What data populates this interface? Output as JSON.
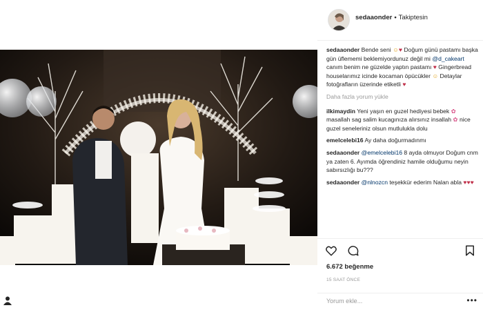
{
  "post": {
    "username": "sedaaonder",
    "separator": "•",
    "follow_status": "Takiptesin",
    "likes": "6.672 beğenme",
    "time": "15 SAAT ÖNCE",
    "comment_placeholder": "Yorum ekle...",
    "more_options": "•••",
    "more_comments": "Daha fazla yorum yükle"
  },
  "caption": {
    "user": "sedaaonder",
    "t1": "Bende seni",
    "t2": "Doğum günü pastamı başka gün üflememi beklemiyordunuz değil mi",
    "mention": "@d_cakeart",
    "t3": "canım benim ne güzelde yaptın pastamı",
    "t4": "Gingerbread houselarımız icinde kocaman öpücükler",
    "t5": "Detaylar fotoğrafların üzerinde etiketli"
  },
  "comments": [
    {
      "user": "ilkimaydin",
      "t1": "Yeni yaşın en guzel hediyesi bebek",
      "t2": "masallah sag salim kucagınıza alırsınız insallah",
      "t3": "nice guzel seneleriniz olsun mutlulukla dolu"
    },
    {
      "user": "emelcelebi16",
      "t1": "Ay daha doğurmadınmı"
    },
    {
      "user": "sedaaonder",
      "mention": "@emelcelebi16",
      "t1": "8 ayda olmuyor Doğum cnm ya zaten 6. Ayımda öğrendiniz hamile olduğumu neyin sabırsızlığı bu???"
    },
    {
      "user": "sedaaonder",
      "mention": "@nlnozcn",
      "t1": "teşekkür ederim",
      "t2": "Nalan abla"
    }
  ],
  "icons": {
    "heart": "heart-icon",
    "comment": "comment-icon",
    "bookmark": "bookmark-icon",
    "avatar": "avatar"
  },
  "colors": {
    "text": "#262626",
    "muted": "#999999",
    "mention": "#003569",
    "border": "#efefef"
  }
}
